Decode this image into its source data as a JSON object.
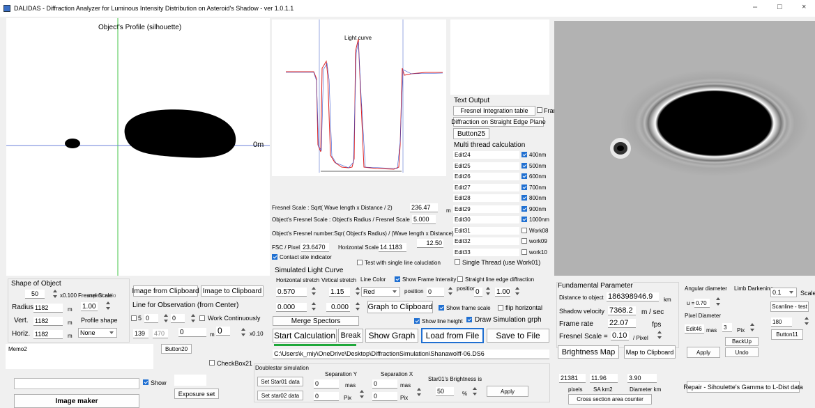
{
  "window": {
    "title": "DALIDAS - Diffraction Analyzer for Luminous Intensity Distribution on Asteroid's Shadow - ver 1.0.1.1",
    "min": "–",
    "max": "□",
    "close": "×"
  },
  "profile": {
    "title": "Object's Profile (silhouette)",
    "zero": "0m"
  },
  "lightcurve": {
    "title": "Light curve"
  },
  "text_output": {
    "label": "Text Output",
    "fresnel_table": "Fresnel Integration table",
    "frame": "Frame",
    "diffraction": "Diffraction on Straight Edge Plane",
    "button25": "Button25"
  },
  "multithread": {
    "label": "Multi thread calculation",
    "edits": [
      "Edit24",
      "Edit25",
      "Edit26",
      "Edit27",
      "Edit28",
      "Edit29",
      "Edit30",
      "Edit31",
      "Edit32",
      "Edit33"
    ],
    "checks": [
      {
        "label": "400nm",
        "on": true
      },
      {
        "label": "500nm",
        "on": true
      },
      {
        "label": "600nm",
        "on": true
      },
      {
        "label": "700nm",
        "on": true
      },
      {
        "label": "800nm",
        "on": true
      },
      {
        "label": "900nm",
        "on": true
      },
      {
        "label": "1000nm",
        "on": true
      },
      {
        "label": "Work08",
        "on": false
      },
      {
        "label": "work09",
        "on": false
      },
      {
        "label": "work10",
        "on": false
      }
    ],
    "single_thread": "Single Thread (use Work01)"
  },
  "fresnel": {
    "scale_label": "Fresnel Scale : Sqrt( Wave length x Distance / 2)",
    "scale_val": "236.47",
    "scale_unit": "m",
    "obj_label": "Object's Fresnel Scale : Object's Radius / Fresnel Scale",
    "obj_val": "5.000",
    "num_label": "Object's Fresnel number:Sqr( Object's Radius) / (Wave length x Distance)",
    "fsc_label": "FSC / Pixel",
    "fsc_val": "23.6470",
    "hscale_label": "Horizontal Scale",
    "hscale_val": "14.1183",
    "v1250": "12.50",
    "contact": "Contact site indicator",
    "test_single": "Test with single line caluclation"
  },
  "slc": {
    "label": "Simulated Light Curve",
    "hstretch": "Horizontal stretch",
    "vstretch": "Virtical stretch",
    "linecolor": "Line Color",
    "show_frame_int": "Show Frame Intensity",
    "straight_line": "Straight line edge diffraction",
    "h_val": "0.570",
    "v_val": "1.15",
    "color_val": "Red",
    "position": "position",
    "pos1": "0",
    "pos2": "0",
    "pos3": "1.00",
    "r2a": "0.000",
    "r2b": "0.000",
    "graph_clip": "Graph to Clipboard",
    "show_frame_scale": "Show frame scale",
    "flip": "flip horizontal",
    "merge": "Merge Spectors",
    "show_line_h": "Show line height",
    "draw_sim": "Draw Simulation grph",
    "start": "Start Calculation",
    "break": "Break",
    "show_graph": "Show Graph",
    "load": "Load from File",
    "save": "Save to File",
    "path": "C:\\Users\\k_miy\\OneDrive\\Desktop\\DiffractionSimulation\\Shanawolff-06.DS6"
  },
  "shape": {
    "label": "Shape of Object",
    "v50": "50",
    "x0100": "x0.100",
    "fresnel_scale": "Fresnel Scale",
    "aspect": "aspect ratio",
    "radius": "Radius",
    "radius_val": "1182",
    "m": "m",
    "ratio_val": "1.00",
    "vert": "Vert.",
    "vert_val": "1182",
    "profile_shape": "Profile shape",
    "horiz": "Horiz.",
    "horiz_val": "1182",
    "none": "None",
    "img_clip": "Image from Clipboard",
    "img_to_clip": "Image to Clipboard",
    "line_obs": "Line for Observation (from Center)",
    "l5": "5",
    "l0a": "0",
    "l0b": "0",
    "work_cont": "Work Continuously",
    "v139": "139",
    "v470": "470",
    "v0": "0",
    "m2": "m",
    "v0b": "0",
    "x010": "x0.10"
  },
  "memo": {
    "memo2": "Memo2",
    "button20": "Button20",
    "checkbox21": "CheckBox21",
    "show": "Show",
    "exposure": "Exposure set",
    "image_maker": "Image maker"
  },
  "double": {
    "label": "Doublestar simulation",
    "sepY": "Separation Y",
    "sepX": "Separation X",
    "bright": "Star01's Brightness is",
    "set1": "Set Star01 data",
    "set2": "Set star02 data",
    "y1": "0",
    "y2": "0",
    "x1": "0",
    "x2": "0",
    "mas": "mas",
    "pix": "Pix",
    "b": "50",
    "pct": "%",
    "apply": "Apply"
  },
  "fund": {
    "label": "Fundamental Parameter",
    "dist": "Distance to object",
    "dist_val": "186398946.9",
    "km": "km",
    "vel": "Shadow velocity",
    "vel_val": "7368.2",
    "mps": "m / sec",
    "frame": "Frame rate",
    "frame_val": "22.07",
    "fps": "fps",
    "fresnel": "Fresnel Scale =",
    "fresnel_val": "0.10",
    "per_pix": "/ Pixel",
    "bmap": "Brightness Map",
    "map_clip": "Map to Clipboard",
    "pixels": "pixels",
    "pixels_val": "21381",
    "sa": "SA km2",
    "sa_val": "11.96",
    "dia": "Diameter km",
    "dia_val": "3.90",
    "cross": "Cross section area counter",
    "repair": "Repair - Sihoulette's Gamma to L-Dist data"
  },
  "angular": {
    "label": "Angular diameter",
    "limb": "Limb Darkening",
    "u": "u =",
    "u_val": "0.70",
    "pixdia": "Pixel Diameter",
    "edit46": "Edit46",
    "mas": "mas",
    "pix_val": "3",
    "pix": "Pix",
    "backup": "BackUp",
    "apply": "Apply",
    "undo": "Undo",
    "scale_val": "0.1",
    "scale": "Scale",
    "scanline": "Scanline - test",
    "v180": "180",
    "button11": "Button11"
  }
}
